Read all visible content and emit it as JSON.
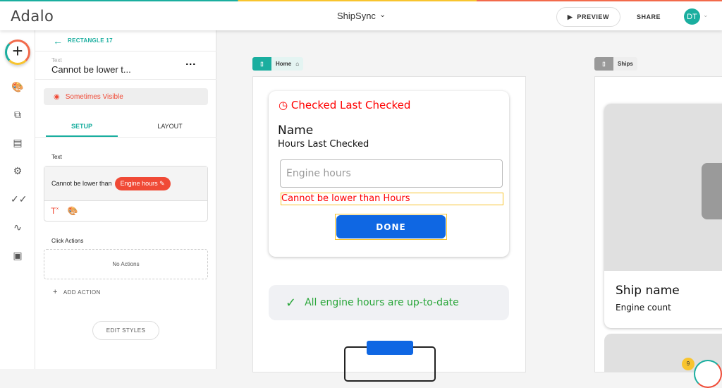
{
  "topbar": {
    "logo": "Adalo",
    "app_name": "ShipSync",
    "preview": "PREVIEW",
    "share": "SHARE",
    "avatar": "DT"
  },
  "panel": {
    "back_label": "RECTANGLE 17",
    "component_type": "Text",
    "component_name": "Cannot be lower t...",
    "visibility": "Sometimes Visible",
    "tabs": [
      "SETUP",
      "LAYOUT"
    ],
    "text_label": "Text",
    "text_value": "Cannot be lower than",
    "text_chip": "Engine hours",
    "click_actions_label": "Click Actions",
    "no_actions": "No Actions",
    "add_action": "ADD ACTION",
    "edit_styles": "EDIT STYLES"
  },
  "home": {
    "tag": "Home",
    "status": "Checked Last Checked",
    "name": "Name",
    "hours": "Hours Last Checked",
    "input_placeholder": "Engine hours",
    "error": "Cannot be lower than Hours",
    "done": "DONE",
    "success": "All engine hours are up-to-date"
  },
  "ships": {
    "tag": "Ships",
    "ship_name": "Ship name",
    "engine_count": "Engine count",
    "badge": "9"
  },
  "colors": {
    "teal": "#1aae9f",
    "red": "#f04a36",
    "blue": "#0f67e3",
    "green": "#2aa63a"
  }
}
